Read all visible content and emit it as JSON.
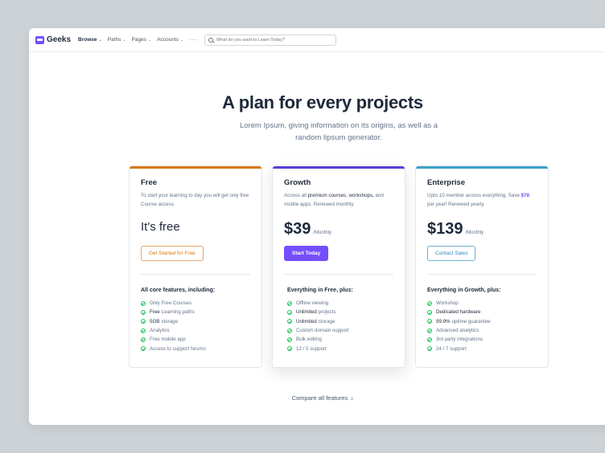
{
  "nav": {
    "logo_text": "Geeks",
    "items": [
      {
        "label": "Browse",
        "active": true
      },
      {
        "label": "Paths",
        "active": false
      },
      {
        "label": "Pages",
        "active": false
      },
      {
        "label": "Accounts",
        "active": false
      }
    ],
    "more_label": "···",
    "search_placeholder": "What do you want to Learn Today?"
  },
  "hero": {
    "title": "A plan for every projects",
    "subtitle": "Lorem Ipsum, giving information on its origins, as well as a random lipsum generator."
  },
  "plans": [
    {
      "name": "Free",
      "desc": "To start your learning to day you will get only free Course access.",
      "price": "It's free",
      "per": "",
      "button": "Get Started for Free",
      "accent": "#d97706",
      "features_title": "All core features, including:",
      "features": [
        {
          "strong": "",
          "text": "Only Free Courses"
        },
        {
          "strong": "Free",
          "text": "Learning paths"
        },
        {
          "strong": "5GB",
          "text": "storage"
        },
        {
          "strong": "",
          "text": "Analytics"
        },
        {
          "strong": "",
          "text": "Free mobile app"
        },
        {
          "strong": "",
          "text": "Access to support forums"
        }
      ]
    },
    {
      "name": "Growth",
      "desc_pre": "Access all ",
      "desc_strong": "premium courses, workshops,",
      "desc_post": " and mobile apps. Renewed monthly.",
      "price": "$39",
      "per": "/Monthly",
      "button": "Start Today",
      "accent": "#5b3cdb",
      "features_title": "Everything in Free, plus:",
      "features": [
        {
          "strong": "",
          "text": "Offline viewing"
        },
        {
          "strong": "Unlimited",
          "text": "projects"
        },
        {
          "strong": "Unlimited",
          "text": "storage"
        },
        {
          "strong": "",
          "text": "Custom domain support"
        },
        {
          "strong": "",
          "text": "Bulk editing"
        },
        {
          "strong": "",
          "text": "12 / 5 support"
        }
      ]
    },
    {
      "name": "Enterprise",
      "desc_pre": "Upto 10 member access everything. Save ",
      "desc_strong": "$78",
      "desc_post": " per year! Renewed yearly.",
      "price": "$139",
      "per": "/Monthly",
      "button": "Contact Sales",
      "accent": "#3aa0c9",
      "features_title": "Everything in Growth, plus:",
      "features": [
        {
          "strong": "",
          "text": "Workshop"
        },
        {
          "strong": "",
          "text": "Dedicated hardware"
        },
        {
          "strong": "99.9%",
          "text": "uptime guarantee"
        },
        {
          "strong": "",
          "text": "Advanced analytics"
        },
        {
          "strong": "",
          "text": "3rd party integrations"
        },
        {
          "strong": "",
          "text": "24 / 7 support"
        }
      ]
    }
  ],
  "footer": {
    "compare_label": "Compare all features",
    "compare_icon": "arrow-down-icon"
  }
}
